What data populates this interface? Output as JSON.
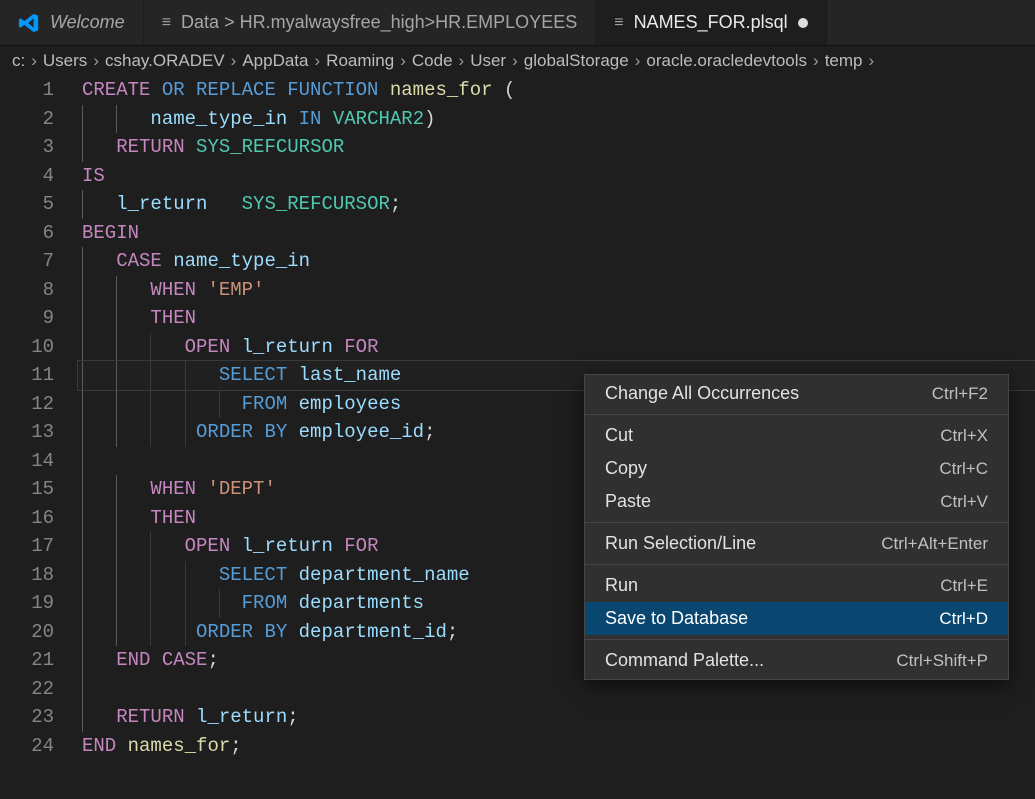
{
  "tabs": [
    {
      "label": "Welcome",
      "kind": "welcome"
    },
    {
      "label": "Data > HR.myalwaysfree_high>HR.EMPLOYEES",
      "kind": "data"
    },
    {
      "label": "NAMES_FOR.plsql",
      "kind": "file",
      "active": true,
      "dirty": true
    }
  ],
  "breadcrumb": [
    "c:",
    "Users",
    "cshay.ORADEV",
    "AppData",
    "Roaming",
    "Code",
    "User",
    "globalStorage",
    "oracle.oracledevtools",
    "temp"
  ],
  "code": {
    "lines": [
      [
        [
          "kw-mag",
          "CREATE"
        ],
        [
          "punc",
          " "
        ],
        [
          "kw-blue",
          "OR REPLACE FUNCTION"
        ],
        [
          "punc",
          " "
        ],
        [
          "fn",
          "names_for"
        ],
        [
          "punc",
          " ("
        ]
      ],
      [
        [
          "punc",
          "      "
        ],
        [
          "ident",
          "name_type_in"
        ],
        [
          "punc",
          " "
        ],
        [
          "kw-blue",
          "IN"
        ],
        [
          "punc",
          " "
        ],
        [
          "type",
          "VARCHAR2"
        ],
        [
          "punc",
          ")"
        ]
      ],
      [
        [
          "punc",
          "   "
        ],
        [
          "kw-mag",
          "RETURN"
        ],
        [
          "punc",
          " "
        ],
        [
          "type",
          "SYS_REFCURSOR"
        ]
      ],
      [
        [
          "kw-mag",
          "IS"
        ]
      ],
      [
        [
          "punc",
          "   "
        ],
        [
          "ident",
          "l_return"
        ],
        [
          "punc",
          "   "
        ],
        [
          "type",
          "SYS_REFCURSOR"
        ],
        [
          "punc",
          ";"
        ]
      ],
      [
        [
          "kw-mag",
          "BEGIN"
        ]
      ],
      [
        [
          "punc",
          "   "
        ],
        [
          "kw-mag",
          "CASE"
        ],
        [
          "punc",
          " "
        ],
        [
          "ident",
          "name_type_in"
        ]
      ],
      [
        [
          "punc",
          "      "
        ],
        [
          "kw-mag",
          "WHEN"
        ],
        [
          "punc",
          " "
        ],
        [
          "str",
          "'EMP'"
        ]
      ],
      [
        [
          "punc",
          "      "
        ],
        [
          "kw-mag",
          "THEN"
        ]
      ],
      [
        [
          "punc",
          "         "
        ],
        [
          "kw-mag",
          "OPEN"
        ],
        [
          "punc",
          " "
        ],
        [
          "ident",
          "l_return"
        ],
        [
          "punc",
          " "
        ],
        [
          "kw-mag",
          "FOR"
        ]
      ],
      [
        [
          "punc",
          "            "
        ],
        [
          "kw-blue",
          "SELECT"
        ],
        [
          "punc",
          " "
        ],
        [
          "ident",
          "last_name"
        ]
      ],
      [
        [
          "punc",
          "              "
        ],
        [
          "kw-blue",
          "FROM"
        ],
        [
          "punc",
          " "
        ],
        [
          "ident",
          "employees"
        ]
      ],
      [
        [
          "punc",
          "          "
        ],
        [
          "kw-blue",
          "ORDER BY"
        ],
        [
          "punc",
          " "
        ],
        [
          "ident",
          "employee_id"
        ],
        [
          "punc",
          ";"
        ]
      ],
      [
        [
          "punc",
          " "
        ]
      ],
      [
        [
          "punc",
          "      "
        ],
        [
          "kw-mag",
          "WHEN"
        ],
        [
          "punc",
          " "
        ],
        [
          "str",
          "'DEPT'"
        ]
      ],
      [
        [
          "punc",
          "      "
        ],
        [
          "kw-mag",
          "THEN"
        ]
      ],
      [
        [
          "punc",
          "         "
        ],
        [
          "kw-mag",
          "OPEN"
        ],
        [
          "punc",
          " "
        ],
        [
          "ident",
          "l_return"
        ],
        [
          "punc",
          " "
        ],
        [
          "kw-mag",
          "FOR"
        ]
      ],
      [
        [
          "punc",
          "            "
        ],
        [
          "kw-blue",
          "SELECT"
        ],
        [
          "punc",
          " "
        ],
        [
          "ident",
          "department_name"
        ]
      ],
      [
        [
          "punc",
          "              "
        ],
        [
          "kw-blue",
          "FROM"
        ],
        [
          "punc",
          " "
        ],
        [
          "ident",
          "departments"
        ]
      ],
      [
        [
          "punc",
          "          "
        ],
        [
          "kw-blue",
          "ORDER BY"
        ],
        [
          "punc",
          " "
        ],
        [
          "ident",
          "department_id"
        ],
        [
          "punc",
          ";"
        ]
      ],
      [
        [
          "punc",
          "   "
        ],
        [
          "kw-mag",
          "END"
        ],
        [
          "punc",
          " "
        ],
        [
          "kw-mag",
          "CASE"
        ],
        [
          "punc",
          ";"
        ]
      ],
      [
        [
          "punc",
          " "
        ]
      ],
      [
        [
          "punc",
          "   "
        ],
        [
          "kw-mag",
          "RETURN"
        ],
        [
          "punc",
          " "
        ],
        [
          "ident",
          "l_return"
        ],
        [
          "punc",
          ";"
        ]
      ],
      [
        [
          "kw-mag",
          "END"
        ],
        [
          "punc",
          " "
        ],
        [
          "fn",
          "names_for"
        ],
        [
          "punc",
          ";"
        ]
      ]
    ],
    "currentLine": 11
  },
  "contextMenu": {
    "groups": [
      [
        {
          "label": "Change All Occurrences",
          "kbd": "Ctrl+F2"
        }
      ],
      [
        {
          "label": "Cut",
          "kbd": "Ctrl+X"
        },
        {
          "label": "Copy",
          "kbd": "Ctrl+C"
        },
        {
          "label": "Paste",
          "kbd": "Ctrl+V"
        }
      ],
      [
        {
          "label": "Run Selection/Line",
          "kbd": "Ctrl+Alt+Enter"
        }
      ],
      [
        {
          "label": "Run",
          "kbd": "Ctrl+E"
        },
        {
          "label": "Save to Database",
          "kbd": "Ctrl+D",
          "selected": true
        }
      ],
      [
        {
          "label": "Command Palette...",
          "kbd": "Ctrl+Shift+P"
        }
      ]
    ]
  }
}
